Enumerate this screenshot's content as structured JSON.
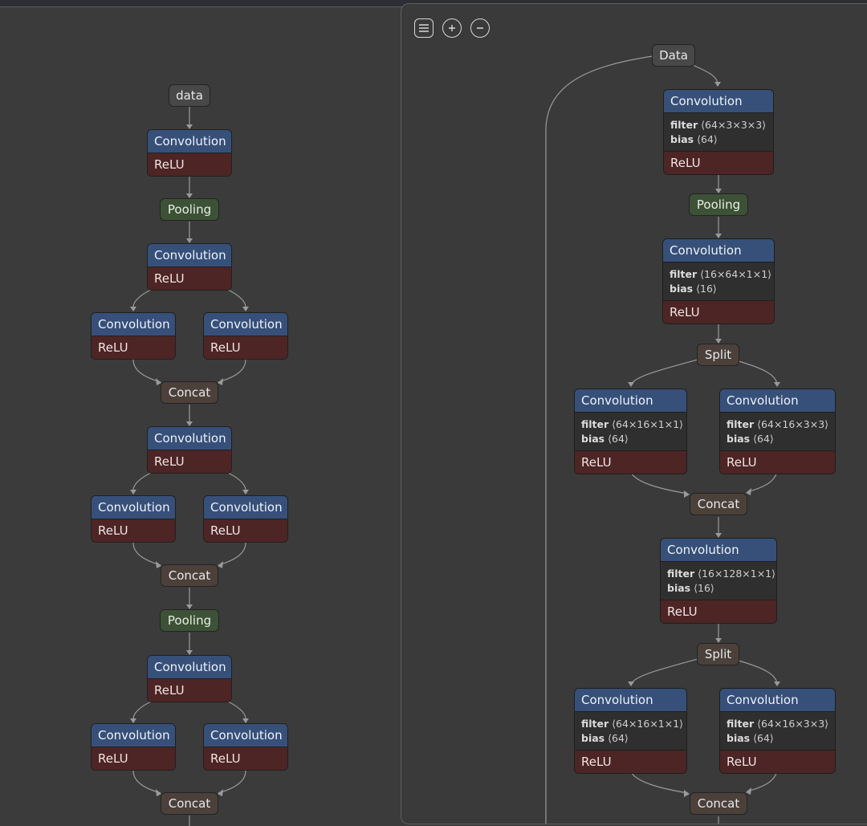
{
  "toolbar": {
    "menu_icon": "hamburger-menu-icon",
    "zoom_in_icon": "zoom-in-icon",
    "zoom_out_icon": "zoom-out-icon"
  },
  "left_graph": {
    "input": "data",
    "conv": "Convolution",
    "relu": "ReLU",
    "pool": "Pooling",
    "concat": "Concat"
  },
  "right_graph": {
    "input": "Data",
    "conv": "Convolution",
    "relu": "ReLU",
    "pool": "Pooling",
    "split": "Split",
    "concat": "Concat",
    "filter_label": "filter",
    "bias_label": "bias",
    "conv1": {
      "filter": "⟨64×3×3×3⟩",
      "bias": "⟨64⟩"
    },
    "squeeze1": {
      "filter": "⟨16×64×1×1⟩",
      "bias": "⟨16⟩"
    },
    "fire1_expand1": {
      "filter": "⟨64×16×1×1⟩",
      "bias": "⟨64⟩"
    },
    "fire1_expand3": {
      "filter": "⟨64×16×3×3⟩",
      "bias": "⟨64⟩"
    },
    "squeeze2": {
      "filter": "⟨16×128×1×1⟩",
      "bias": "⟨16⟩"
    },
    "fire2_expand1": {
      "filter": "⟨64×16×1×1⟩",
      "bias": "⟨64⟩"
    },
    "fire2_expand3": {
      "filter": "⟨64×16×3×3⟩",
      "bias": "⟨64⟩"
    }
  }
}
